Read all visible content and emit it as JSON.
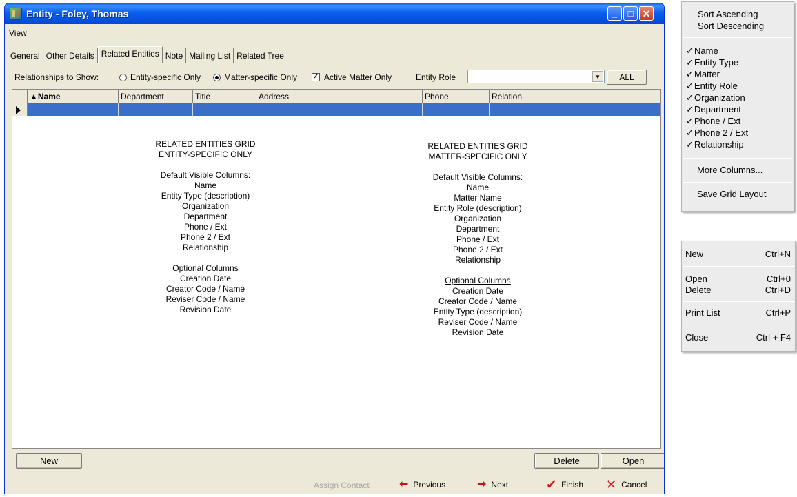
{
  "window": {
    "title": "Entity - Foley, Thomas",
    "minimize": "_",
    "maximize": "□",
    "close": "✕"
  },
  "menu": {
    "view": "View"
  },
  "tabs": [
    "General",
    "Other Details",
    "Related Entities",
    "Note",
    "Mailing List",
    "Related Tree"
  ],
  "relationships": {
    "label": "Relationships to Show:",
    "entity_specific": "Entity-specific Only",
    "matter_specific": "Matter-specific Only",
    "active_matter": "Active Matter Only",
    "selected": "Matter-specific Only",
    "active_matter_checked": true
  },
  "entity_role": {
    "label": "Entity Role",
    "value": "",
    "all_button": "ALL"
  },
  "grid": {
    "columns": [
      "▲Name",
      "Department",
      "Title",
      "Address",
      "Phone",
      "Relation"
    ]
  },
  "notes_entity": {
    "title1": "RELATED ENTITIES GRID",
    "title2": "ENTITY-SPECIFIC ONLY",
    "default_heading": "Default Visible Columns:",
    "default_columns": [
      "Name",
      "Entity Type (description)",
      "Organization",
      "Department",
      "Phone / Ext",
      "Phone 2 / Ext",
      "Relationship"
    ],
    "optional_heading": "Optional Columns",
    "optional_columns": [
      "Creation Date",
      "Creator Code / Name",
      "Reviser Code / Name",
      "Revision Date"
    ]
  },
  "notes_matter": {
    "title1": "RELATED ENTITIES GRID",
    "title2": "MATTER-SPECIFIC ONLY",
    "default_heading": "Default Visible Columns:",
    "default_columns": [
      "Name",
      "Matter Name",
      "Entity Role (description)",
      "Organization",
      "Department",
      "Phone / Ext",
      "Phone 2 / Ext",
      "Relationship"
    ],
    "optional_heading": "Optional Columns",
    "optional_columns": [
      "Creation Date",
      "Creator Code / Name",
      "Entity Type (description)",
      "Reviser Code / Name",
      "Revision Date"
    ]
  },
  "buttons": {
    "new": "New",
    "delete": "Delete",
    "open": "Open"
  },
  "nav": {
    "assign_contact": "Assign Contact",
    "previous": "Previous",
    "next": "Next",
    "finish": "Finish",
    "cancel": "Cancel"
  },
  "column_menu": {
    "sort_ascending": "Sort Ascending",
    "sort_descending": "Sort Descending",
    "columns": [
      "Name",
      "Entity Type",
      "Matter",
      "Entity Role",
      "Organization",
      "Department",
      "Phone / Ext",
      "Phone 2 / Ext",
      "Relationship"
    ],
    "check": "✓",
    "more_columns": "More Columns...",
    "save_layout": "Save Grid Layout"
  },
  "file_menu": [
    {
      "label": "New",
      "shortcut": "Ctrl+N"
    },
    {
      "label": "Open",
      "shortcut": "Ctrl+0"
    },
    {
      "label": "Delete",
      "shortcut": "Ctrl+D"
    },
    {
      "label": "Print List",
      "shortcut": "Ctrl+P"
    },
    {
      "label": "Close",
      "shortcut": "Ctrl + F4"
    }
  ],
  "colors": {
    "titlebar": "#0a5fe6",
    "selected_row": "#3a6ec8",
    "window_bg": "#ece9d8"
  },
  "icons": {
    "app": "app-icon",
    "previous": "arrow-left-icon",
    "next": "arrow-right-icon",
    "finish": "checkmark-icon",
    "cancel": "x-icon"
  }
}
